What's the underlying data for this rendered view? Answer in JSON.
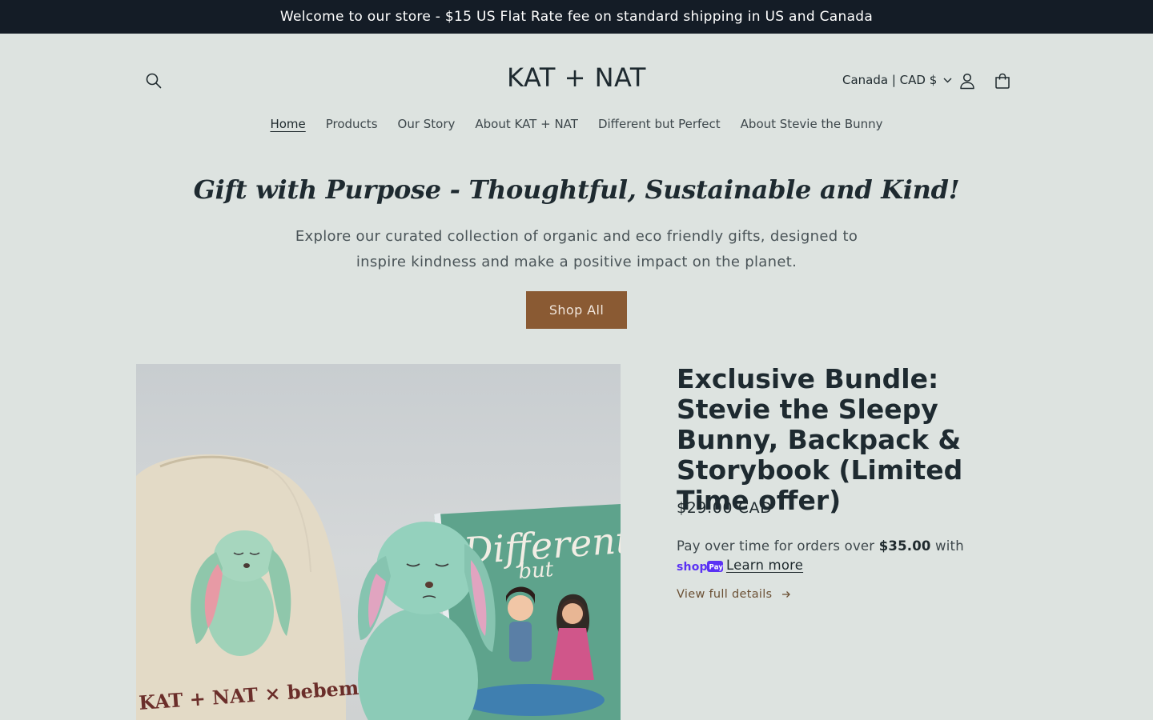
{
  "announcement": "Welcome to our store - $15 US Flat Rate fee on standard shipping in US and Canada",
  "header": {
    "logo": "KAT + NAT",
    "locale": "Canada | CAD $",
    "icons": {
      "search": "search-icon",
      "account": "account-icon",
      "cart": "cart-icon",
      "locale_toggle": "chevron-down-icon"
    }
  },
  "nav": {
    "items": [
      {
        "label": "Home",
        "active": true
      },
      {
        "label": "Products"
      },
      {
        "label": "Our Story"
      },
      {
        "label": "About KAT + NAT"
      },
      {
        "label": "Different but Perfect"
      },
      {
        "label": "About Stevie the Bunny"
      }
    ]
  },
  "hero": {
    "title": "Gift with Purpose - Thoughtful, Sustainable and Kind!",
    "text": "Explore our curated collection of organic and eco friendly gifts, designed to inspire kindness and make a positive impact on the planet.",
    "button": "Shop All"
  },
  "featured_product": {
    "title": "Exclusive Bundle: Stevie the Sleepy Bunny, Backpack & Storybook (Limited Time offer)",
    "price": "$29.00 CAD",
    "installments_prefix": "Pay over time for orders over",
    "installments_threshold": "$35.00",
    "installments_suffix": "with",
    "shoppay_logo": "shop Pay",
    "learn_more": "Learn more",
    "view_details": "View full details",
    "view_details_icon": "arrow-right-icon",
    "image_text": {
      "bag_brand": "KAT + NAT × bebemoss",
      "book_title_1": "Different",
      "book_title_2": "but"
    }
  },
  "colors": {
    "page_bg": "#dde3e0",
    "announcement_bg": "#141c26",
    "button_bg": "#8a5a33",
    "shoppay_purple": "#5a31f4",
    "link_brown": "#6b5034"
  }
}
